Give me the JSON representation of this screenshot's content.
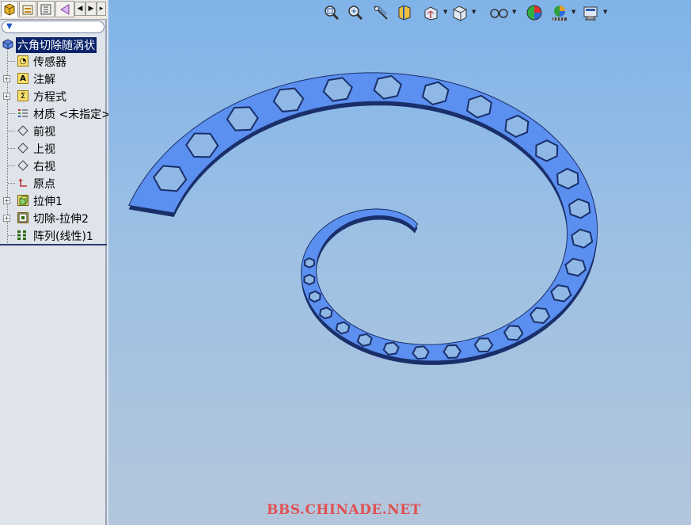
{
  "panel_tabs": [
    {
      "icon": "feature-manager-icon",
      "active": true
    },
    {
      "icon": "property-manager-icon",
      "active": false
    },
    {
      "icon": "configuration-manager-icon",
      "active": false
    },
    {
      "icon": "dimxpert-icon",
      "active": false
    }
  ],
  "tree": {
    "root": "六角切除随涡状",
    "items": [
      {
        "label": "传感器",
        "icon": "sensors-icon",
        "expandable": false
      },
      {
        "label": "注解",
        "icon": "annotations-icon",
        "expandable": true
      },
      {
        "label": "方程式",
        "icon": "equations-icon",
        "expandable": true
      },
      {
        "label": "材质 <未指定>",
        "icon": "material-icon",
        "expandable": false
      },
      {
        "label": "前视",
        "icon": "plane-icon",
        "expandable": false
      },
      {
        "label": "上视",
        "icon": "plane-icon",
        "expandable": false
      },
      {
        "label": "右视",
        "icon": "plane-icon",
        "expandable": false
      },
      {
        "label": "原点",
        "icon": "origin-icon",
        "expandable": false
      },
      {
        "label": "拉伸1",
        "icon": "extrude-icon",
        "expandable": true
      },
      {
        "label": "切除-拉伸2",
        "icon": "cut-extrude-icon",
        "expandable": true
      },
      {
        "label": "阵列(线性)1",
        "icon": "linear-pattern-icon",
        "expandable": false
      }
    ]
  },
  "view_toolbar": [
    "zoom-to-fit-icon",
    "zoom-to-area-icon",
    "previous-view-icon",
    "section-view-icon",
    "view-orientation-icon",
    "display-style-icon",
    "hide-show-items-icon",
    "edit-appearance-icon",
    "apply-scene-icon",
    "view-settings-icon"
  ],
  "watermark": "BBS.CHINADE.NET",
  "colors": {
    "part": "#5b8ff0",
    "part_edge": "#1a2f6a",
    "selection": "#0a246a"
  }
}
